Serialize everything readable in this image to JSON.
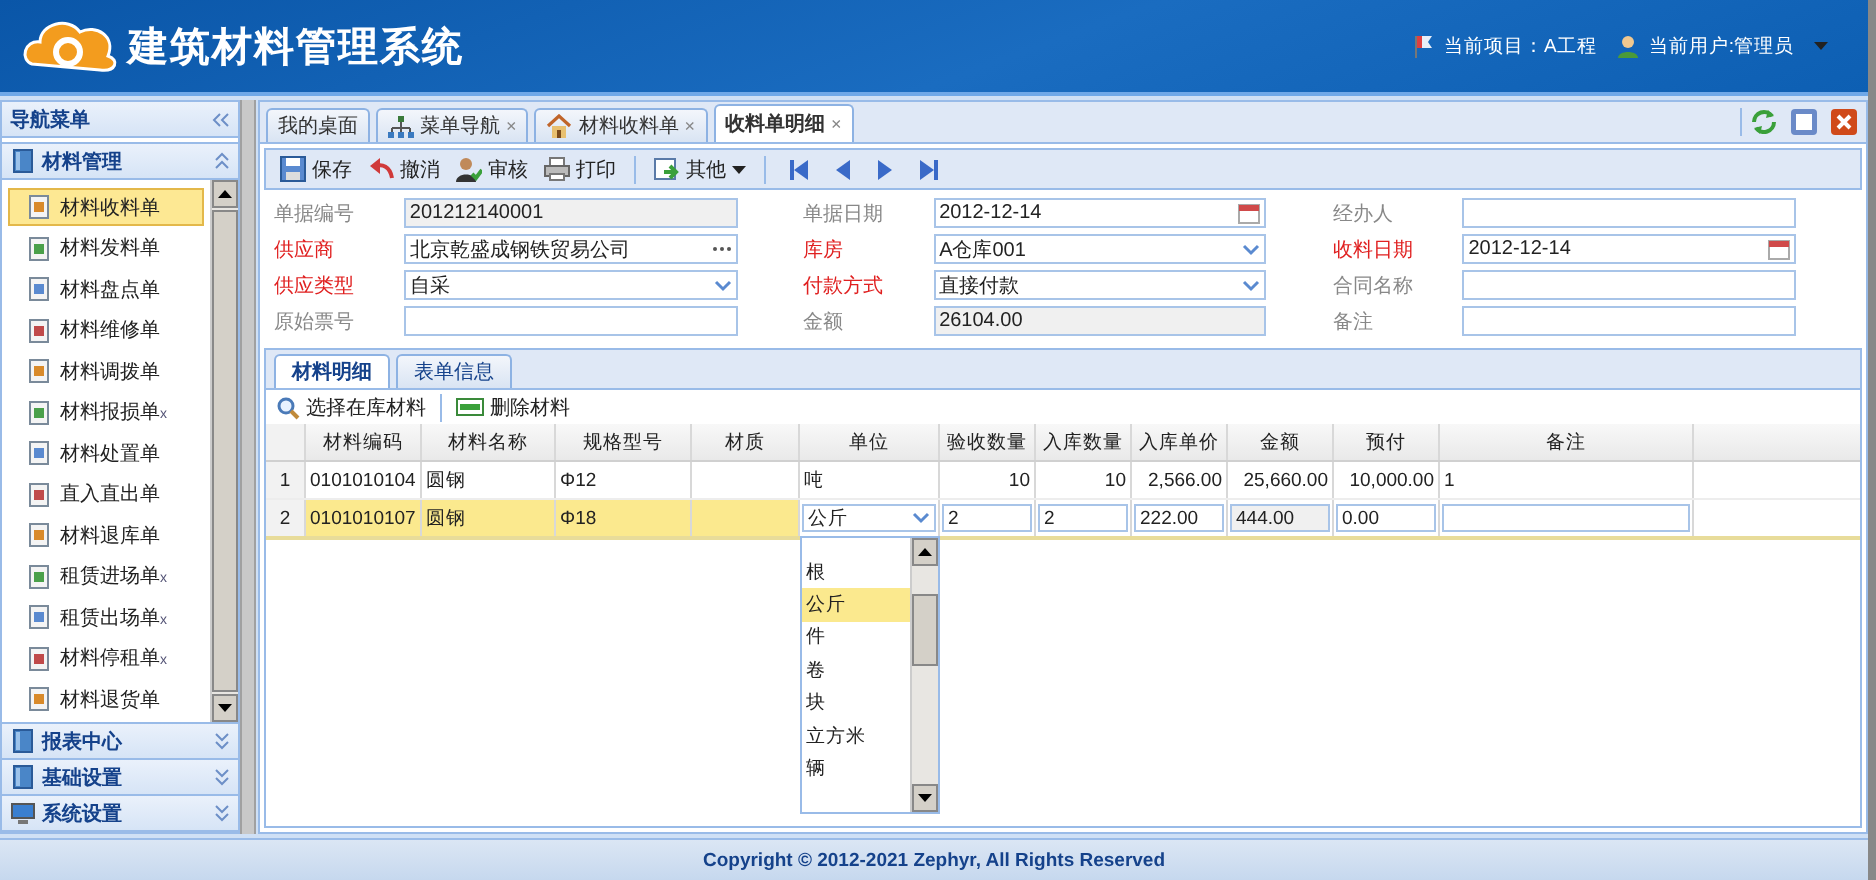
{
  "header": {
    "title": "建筑材料管理系统",
    "project": "当前项目：A工程",
    "user": "当前用户:管理员"
  },
  "sidebar": {
    "title": "导航菜单",
    "sections": [
      {
        "label": "材料管理",
        "expanded": true,
        "items": [
          {
            "label": "材料收料单",
            "selected": true
          },
          {
            "label": "材料发料单",
            "selected": false
          },
          {
            "label": "材料盘点单",
            "selected": false
          },
          {
            "label": "材料维修单",
            "selected": false
          },
          {
            "label": "材料调拨单",
            "selected": false
          },
          {
            "label": "材料报损单",
            "suffix": "x",
            "selected": false
          },
          {
            "label": "材料处置单",
            "selected": false
          },
          {
            "label": "直入直出单",
            "selected": false
          },
          {
            "label": "材料退库单",
            "selected": false
          },
          {
            "label": "租赁进场单",
            "suffix": "x",
            "selected": false
          },
          {
            "label": "租赁出场单",
            "suffix": "x",
            "selected": false
          },
          {
            "label": "材料停租单",
            "suffix": "x",
            "selected": false
          },
          {
            "label": "材料退货单",
            "selected": false
          }
        ]
      },
      {
        "label": "报表中心",
        "expanded": false
      },
      {
        "label": "基础设置",
        "expanded": false
      },
      {
        "label": "系统设置",
        "expanded": false
      }
    ]
  },
  "tabs": [
    {
      "label": "我的桌面",
      "selected": false
    },
    {
      "label": "菜单导航",
      "close": "×",
      "selected": false
    },
    {
      "label": "材料收料单",
      "close": "×",
      "selected": false
    },
    {
      "label": "收料单明细",
      "close": "×",
      "selected": true
    }
  ],
  "toolbar": [
    {
      "label": "保存",
      "kind": "button"
    },
    {
      "label": "撤消",
      "kind": "button"
    },
    {
      "label": "审核",
      "kind": "button"
    },
    {
      "label": "打印",
      "kind": "button"
    },
    {
      "label": "其他",
      "kind": "menu"
    }
  ],
  "form": {
    "fields": [
      {
        "label": "单据编号",
        "required": false,
        "kind": "readonly",
        "value": "201212140001"
      },
      {
        "label": "单据日期",
        "required": false,
        "kind": "date",
        "value": "2012-12-14"
      },
      {
        "label": "经办人",
        "required": false,
        "kind": "text"
      },
      {
        "label": "供应商",
        "required": true,
        "kind": "lookup",
        "value": "北京乾盛成钢铁贸易公司"
      },
      {
        "label": "库房",
        "required": true,
        "kind": "select",
        "value": "A仓库001"
      },
      {
        "label": "收料日期",
        "required": true,
        "kind": "date",
        "value": "2012-12-14"
      },
      {
        "label": "供应类型",
        "required": true,
        "kind": "select",
        "value": "自采"
      },
      {
        "label": "付款方式",
        "required": true,
        "kind": "select",
        "value": "直接付款"
      },
      {
        "label": "合同名称",
        "required": false,
        "kind": "text"
      },
      {
        "label": "原始票号",
        "required": false,
        "kind": "text"
      },
      {
        "label": "金额",
        "required": false,
        "kind": "readonly",
        "value": "26104.00"
      },
      {
        "label": "备注",
        "required": false,
        "kind": "text"
      }
    ]
  },
  "detail_tabs": [
    {
      "label": "材料明细",
      "selected": true
    },
    {
      "label": "表单信息",
      "selected": false
    }
  ],
  "detail_toolbar": [
    {
      "label": "选择在库材料"
    },
    {
      "label": "删除材料"
    }
  ],
  "table": {
    "columns": [
      {
        "label": "材料编码",
        "kind": "fixed"
      },
      {
        "label": "材料名称",
        "kind": "fixed"
      },
      {
        "label": "规格型号",
        "kind": "fixed"
      },
      {
        "label": "材质",
        "kind": "fixed"
      },
      {
        "label": "单位",
        "kind": "select"
      },
      {
        "label": "验收数量",
        "kind": "number"
      },
      {
        "label": "入库数量",
        "kind": "number"
      },
      {
        "label": "入库单价",
        "kind": "number"
      },
      {
        "label": "金额",
        "kind": "amount"
      },
      {
        "label": "预付",
        "kind": "number"
      },
      {
        "label": "备注",
        "kind": "text"
      }
    ],
    "rows": [
      {
        "number": "1",
        "selected": false,
        "cells": [
          "0101010104",
          "圆钢",
          "Φ12",
          null,
          "吨",
          "10",
          "10",
          "2,566.00",
          "25,660.00",
          "10,000.00",
          "1"
        ]
      },
      {
        "number": "2",
        "selected": true,
        "cells": [
          "0101010107",
          "圆钢",
          "Φ18",
          null,
          "公斤",
          "2",
          "2",
          "222.00",
          "444.00",
          "0.00",
          null
        ]
      }
    ],
    "unit_dropdown": [
      {
        "label": "根",
        "selected": false
      },
      {
        "label": "公斤",
        "selected": true
      },
      {
        "label": "件",
        "selected": false
      },
      {
        "label": "卷",
        "selected": false
      },
      {
        "label": "块",
        "selected": false
      },
      {
        "label": "立方米",
        "selected": false
      },
      {
        "label": "辆",
        "selected": false
      }
    ]
  },
  "footer": "Copyright © 2012-2021 Zephyr, All Rights Reserved"
}
